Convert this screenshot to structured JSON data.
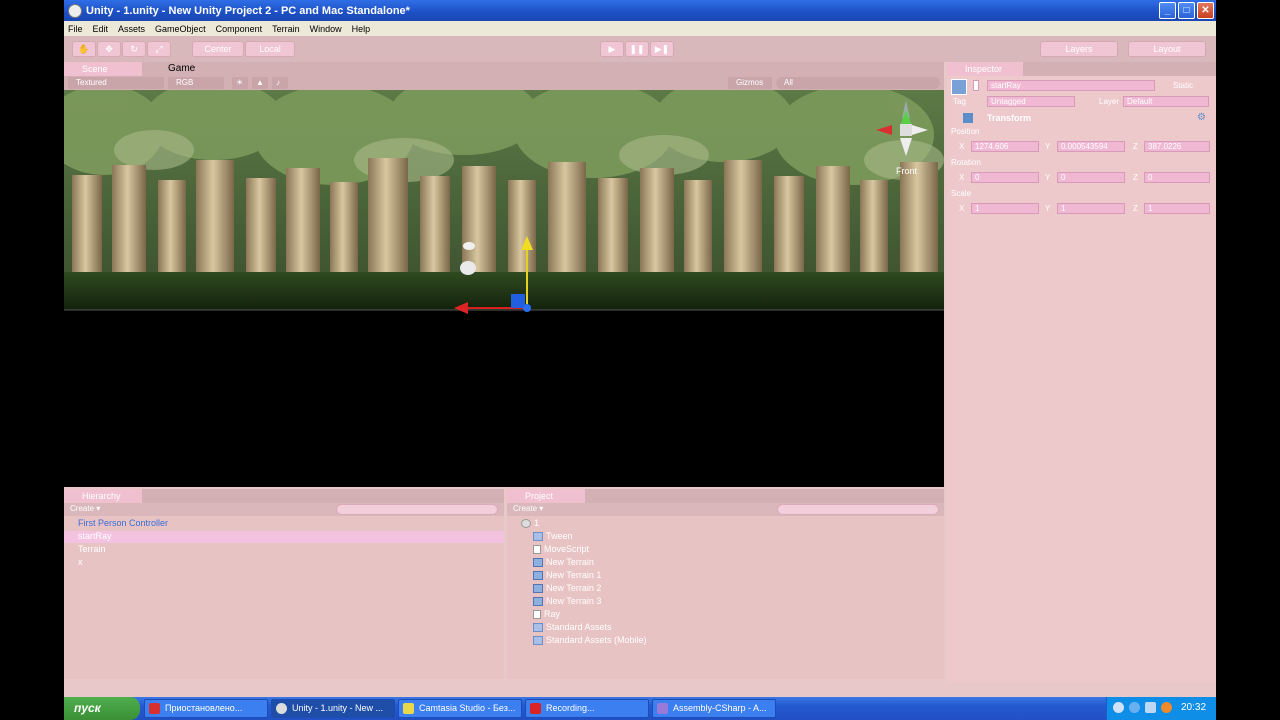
{
  "window": {
    "title": "Unity - 1.unity - New Unity Project 2 - PC and Mac Standalone*"
  },
  "menu": [
    "File",
    "Edit",
    "Assets",
    "GameObject",
    "Component",
    "Terrain",
    "Window",
    "Help"
  ],
  "toolbar": {
    "center_label": "Center",
    "local_label": "Local",
    "layers_label": "Layers",
    "layout_label": "Layout"
  },
  "scene": {
    "tab_scene": "Scene",
    "tab_game": "Game",
    "shading": "Textured",
    "render_mode": "RGB",
    "gizmos": "Gizmos",
    "search_placeholder": "All",
    "view_label": "Front"
  },
  "hierarchy": {
    "title": "Hierarchy",
    "create": "Create",
    "items": [
      "First Person Controller",
      "startRay",
      "Terrain",
      "x"
    ]
  },
  "project": {
    "title": "Project",
    "create": "Create",
    "items": [
      {
        "label": "1",
        "icon": "unity-icon"
      },
      {
        "label": "Tween",
        "icon": "folder-icon"
      },
      {
        "label": "MoveScript",
        "icon": "script-icon"
      },
      {
        "label": "New Terrain",
        "icon": "terrain-icon"
      },
      {
        "label": "New Terrain 1",
        "icon": "terrain-icon"
      },
      {
        "label": "New Terrain 2",
        "icon": "terrain-icon"
      },
      {
        "label": "New Terrain 3",
        "icon": "terrain-icon"
      },
      {
        "label": "Ray",
        "icon": "file-icon"
      },
      {
        "label": "Standard Assets",
        "icon": "folder-icon"
      },
      {
        "label": "Standard Assets (Mobile)",
        "icon": "folder-icon"
      }
    ]
  },
  "inspector": {
    "title": "Inspector",
    "object_name": "startRay",
    "static": "Static",
    "tag_label": "Tag",
    "tag_value": "Untagged",
    "layer_label": "Layer",
    "layer_value": "Default",
    "component": "Transform",
    "position_label": "Position",
    "position": {
      "x": "1274.606",
      "y": "0.000543594",
      "z": "387.0226"
    },
    "rotation_label": "Rotation",
    "rotation": {
      "x": "0",
      "y": "0",
      "z": "0"
    },
    "scale_label": "Scale",
    "scale": {
      "x": "1",
      "y": "1",
      "z": "1"
    }
  },
  "taskbar": {
    "start": "пуск",
    "items": [
      "Приостановлено...",
      "Unity - 1.unity - New ...",
      "Camtasia Studio - Без...",
      "Recording...",
      "Assembly-CSharp - A..."
    ],
    "clock": "20:32"
  }
}
